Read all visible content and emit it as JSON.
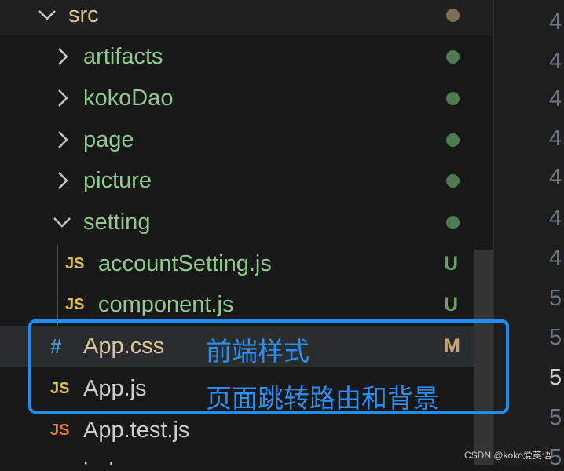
{
  "explorer": {
    "src": {
      "label": "src"
    },
    "folders": [
      {
        "label": "artifacts"
      },
      {
        "label": "kokoDao"
      },
      {
        "label": "page"
      },
      {
        "label": "picture"
      },
      {
        "label": "setting"
      }
    ],
    "setting_files": [
      {
        "icon": "JS",
        "label": "accountSetting.js",
        "status": "U"
      },
      {
        "icon": "JS",
        "label": "component.js",
        "status": "U"
      }
    ],
    "files": [
      {
        "icon": "#",
        "label": "App.css",
        "status": "M"
      },
      {
        "icon": "JS",
        "label": "App.js"
      },
      {
        "icon": "JS",
        "label": "App.test.js"
      },
      {
        "icon": "#",
        "label": "inde"
      }
    ]
  },
  "gutter": {
    "line_numbers": [
      "4",
      "4",
      "4",
      "4",
      "4",
      "4",
      "4",
      "5",
      "5",
      "5",
      "5",
      "5"
    ]
  },
  "annotations": {
    "css": "前端样式",
    "js": "页面跳转路由和背景"
  },
  "watermark": "CSDN @koko爱英语",
  "colors": {
    "folder_green": "#8fc98f",
    "file_tan": "#dcc397",
    "annotation_blue": "#1e8ff0",
    "js_yellow": "#d8c152",
    "css_blue": "#4a90c8"
  }
}
